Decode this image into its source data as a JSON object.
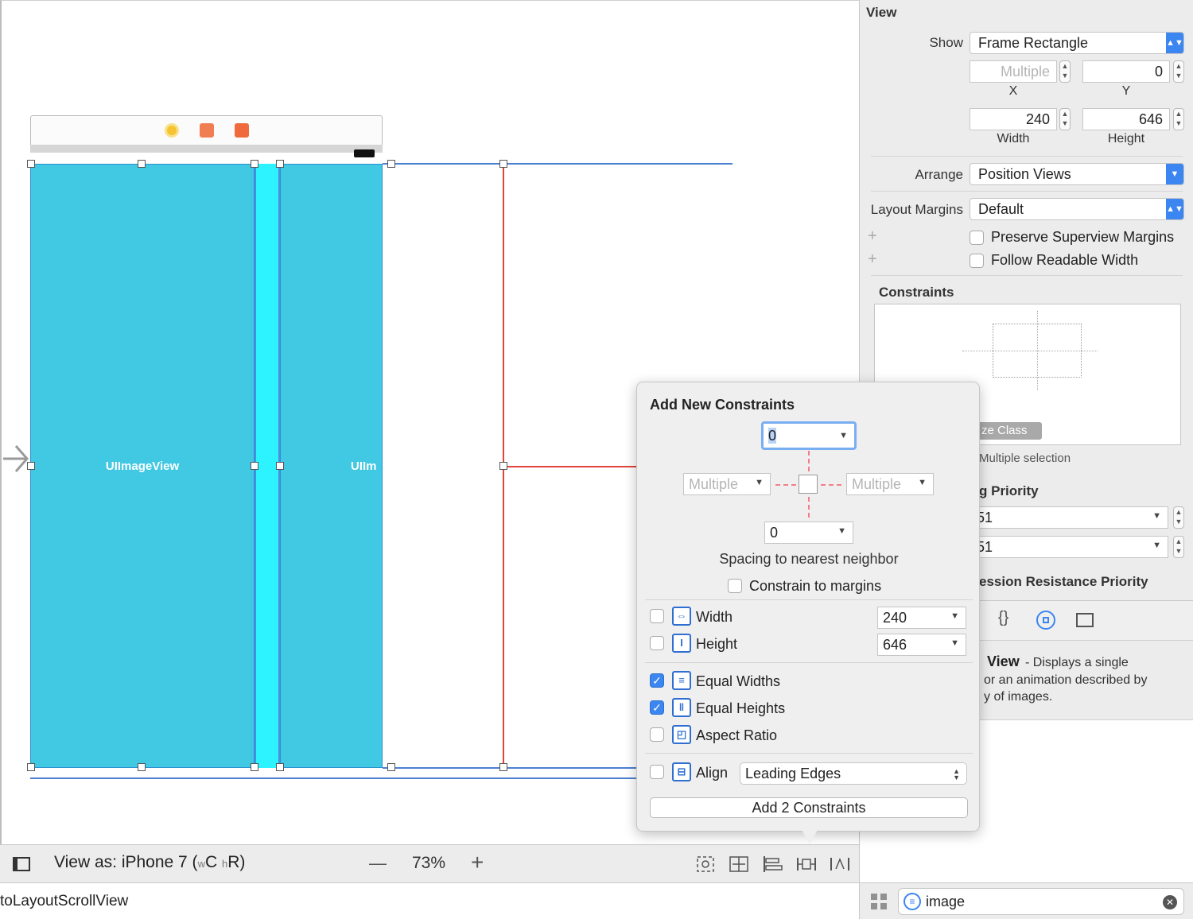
{
  "canvas": {
    "view_label_1": "UIImageView",
    "view_label_2": "UIIm"
  },
  "bottom_bar": {
    "view_as": "View as: iPhone 7 (",
    "size_w": "w",
    "size_c": "C",
    "size_h": "h",
    "size_r": "R)",
    "zoom_minus": "—",
    "zoom": "73%",
    "zoom_plus": "+"
  },
  "status_bar": {
    "class_name": "toLayoutScrollView"
  },
  "inspector": {
    "section_view": "View",
    "show_label": "Show",
    "show_value": "Frame Rectangle",
    "x_value": "Multiple",
    "y_value": "0",
    "x_label": "X",
    "y_label": "Y",
    "width_value": "240",
    "height_value": "646",
    "width_label": "Width",
    "height_label": "Height",
    "arrange_label": "Arrange",
    "arrange_value": "Position Views",
    "layout_margins_label": "Layout Margins",
    "layout_margins_value": "Default",
    "preserve_margins": "Preserve Superview Margins",
    "follow_readable": "Follow Readable Width",
    "plus": "+",
    "constraints_title": "Constraints",
    "size_class_tag": "ze Class",
    "multiple_selection": "Multiple selection",
    "hugging_priority": "g Priority",
    "hugging_h": "51",
    "hugging_v": "51",
    "compression_priority": "ession Resistance Priority",
    "library_title": "View",
    "library_desc_1": "- Displays a single",
    "library_desc_2": "or an animation described by",
    "library_desc_3": "y of images.",
    "filter_value": "image"
  },
  "popover": {
    "title": "Add New Constraints",
    "top_value": "0",
    "left_value": "Multiple",
    "right_value": "Multiple",
    "bottom_value": "0",
    "spacing_label": "Spacing to nearest neighbor",
    "constrain_margins": "Constrain to margins",
    "width_label": "Width",
    "width_value": "240",
    "height_label": "Height",
    "height_value": "646",
    "equal_widths": "Equal Widths",
    "equal_heights": "Equal Heights",
    "aspect_ratio": "Aspect Ratio",
    "align_label": "Align",
    "align_value": "Leading Edges",
    "add_button": "Add 2 Constraints",
    "check": "✓"
  },
  "colors": {
    "image_view": "#41c8e2",
    "spacer_view": "#2cf3ff",
    "accent": "#3b86f0",
    "constraint_red": "#e0453a"
  }
}
